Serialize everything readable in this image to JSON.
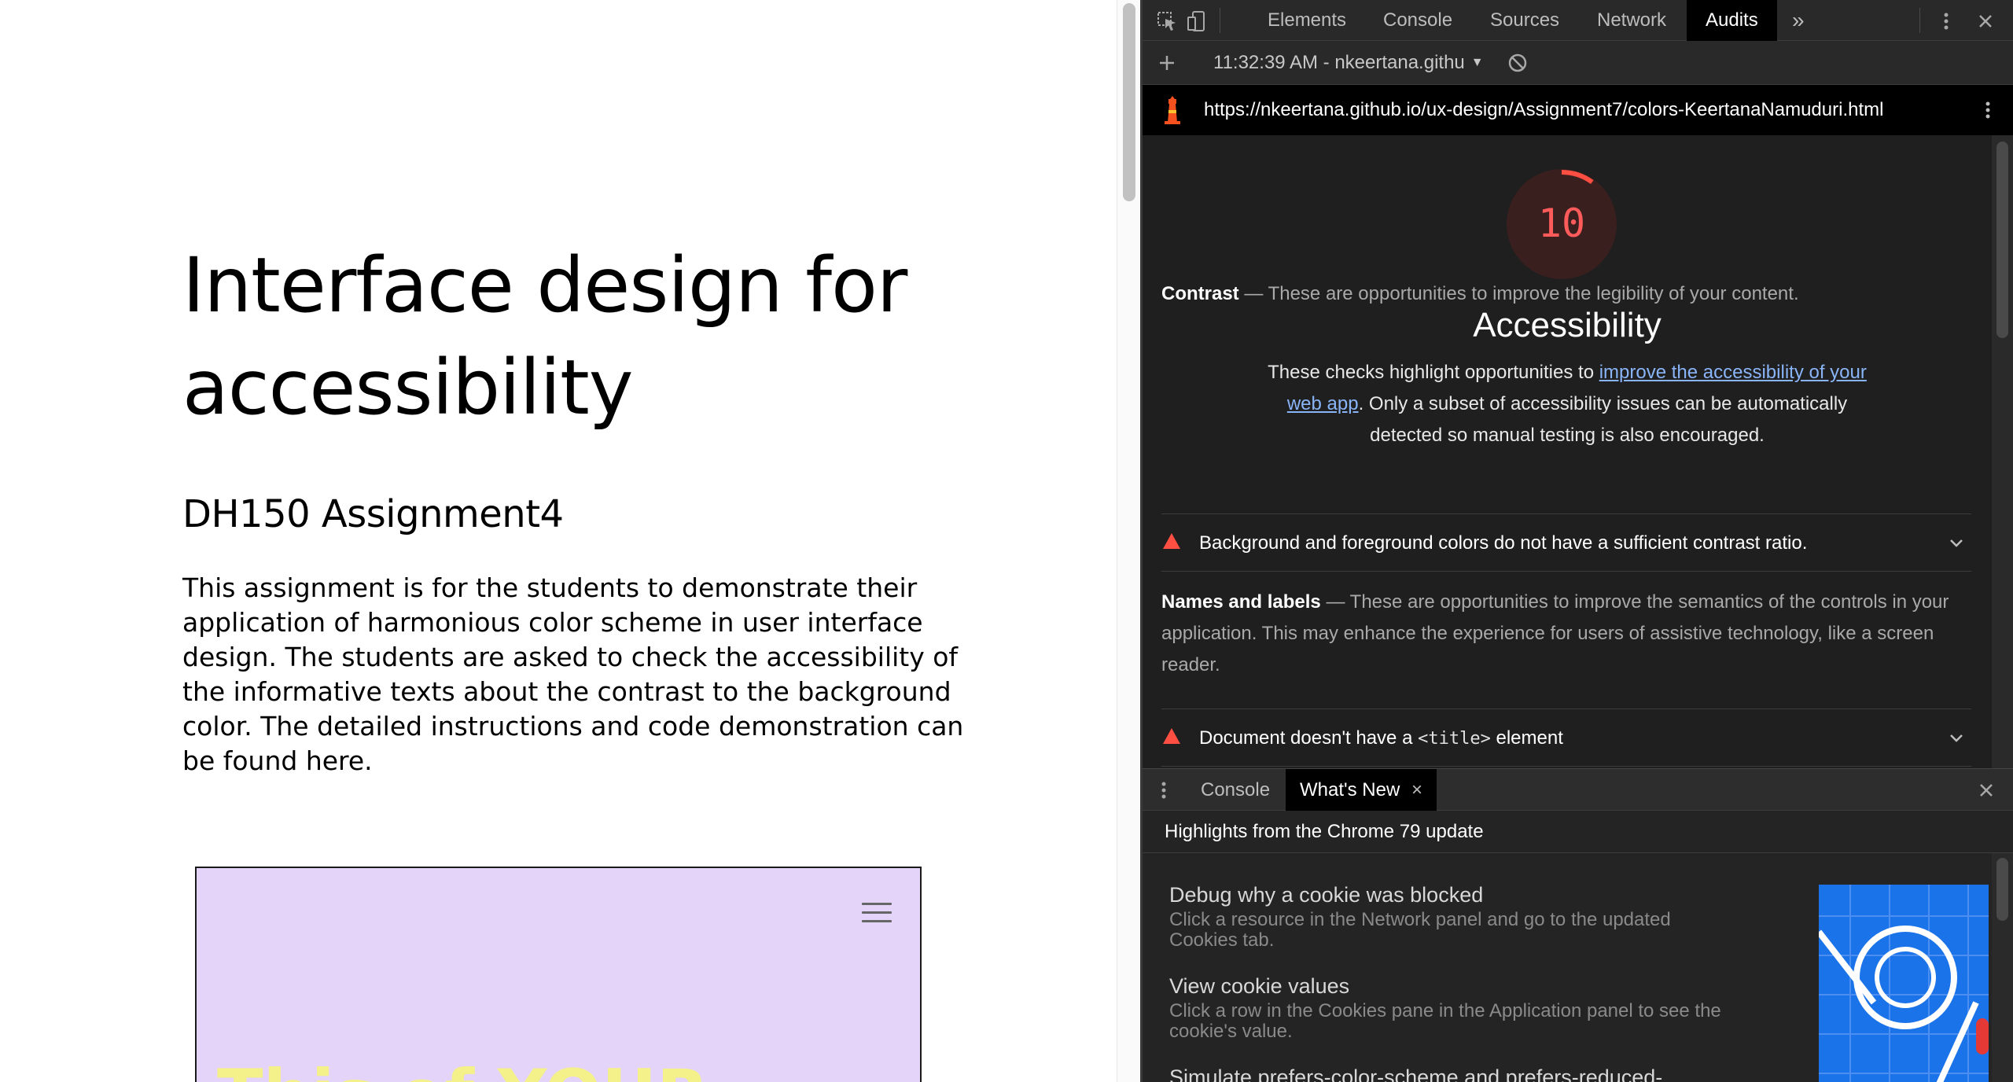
{
  "page": {
    "title": "Interface design for accessibility",
    "subtitle": "DH150 Assignment4",
    "paragraph": "This assignment is for the students to demonstrate their application of harmonious color scheme in user interface design. The students are asked to check the accessibility of the informative texts about the contrast to the background color. The detailed instructions and code demonstration can be found here.",
    "demo_heading": "This of YOUR",
    "demo_background": "#e4d4fa",
    "demo_text_color": "#f4f08a"
  },
  "devtools": {
    "tabs": [
      "Elements",
      "Console",
      "Sources",
      "Network",
      "Audits"
    ],
    "active_tab": "Audits",
    "more_tabs_icon": "»",
    "report_time": "11:32:39 AM - nkeertana.githu",
    "report_url": "https://nkeertana.github.io/ux-design/Assignment7/colors-KeertanaNamuduri.html",
    "score": "10",
    "score_value": 0.1,
    "score_color": "#ff4e42",
    "category_title": "Accessibility",
    "category_desc_before": "These checks highlight opportunities to ",
    "category_desc_link": "improve the accessibility of your web app",
    "category_desc_after": ". Only a subset of accessibility issues can be automatically detected so manual testing is also encouraged.",
    "groups": [
      {
        "title": "Contrast",
        "separator": "—",
        "description": "These are opportunities to improve the legibility of your content.",
        "audit": {
          "text": "Background and foreground colors do not have a sufficient contrast ratio.",
          "code": "",
          "suffix": ""
        }
      },
      {
        "title": "Names and labels",
        "separator": "—",
        "description": "These are opportunities to improve the semantics of the controls in your application. This may enhance the experience for users of assistive technology, like a screen reader.",
        "audit": {
          "text": "Document doesn't have a ",
          "code": "<title>",
          "suffix": " element"
        }
      }
    ],
    "drawer": {
      "tabs": [
        "Console",
        "What's New"
      ],
      "active_tab": "What's New",
      "close_tab_icon": "×",
      "highlights": "Highlights from the Chrome 79 update",
      "items": [
        {
          "title": "Debug why a cookie was blocked",
          "description": "Click a resource in the Network panel and go to the updated Cookies tab."
        },
        {
          "title": "View cookie values",
          "description": "Click a row in the Cookies pane in the Application panel to see the cookie's value."
        },
        {
          "title": "Simulate prefers-color-scheme and prefers-reduced-",
          "description": ""
        }
      ]
    },
    "icons": {
      "inspect": "inspect-element-icon",
      "device": "device-toolbar-icon",
      "kebab": "kebab-menu-icon",
      "close": "close-icon",
      "add": "plus-icon",
      "dropdown": "dropdown-arrow-icon",
      "clear": "block-icon",
      "lighthouse": "lighthouse-icon"
    }
  }
}
